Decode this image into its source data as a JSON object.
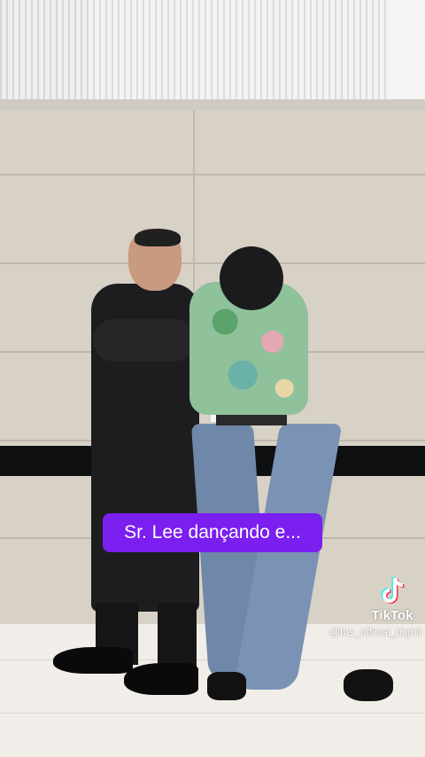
{
  "caption": {
    "text": "Sr. Lee dançando e..."
  },
  "watermark": {
    "app_name": "TikTok",
    "handle": "@bts_official_bighit",
    "icon": "tiktok-logo-icon"
  },
  "colors": {
    "caption_bg": "#7a1ff0",
    "caption_text": "#ffffff",
    "wall": "#d8d1c5",
    "stripe": "#0e0f10",
    "floor": "#f1ede8"
  }
}
